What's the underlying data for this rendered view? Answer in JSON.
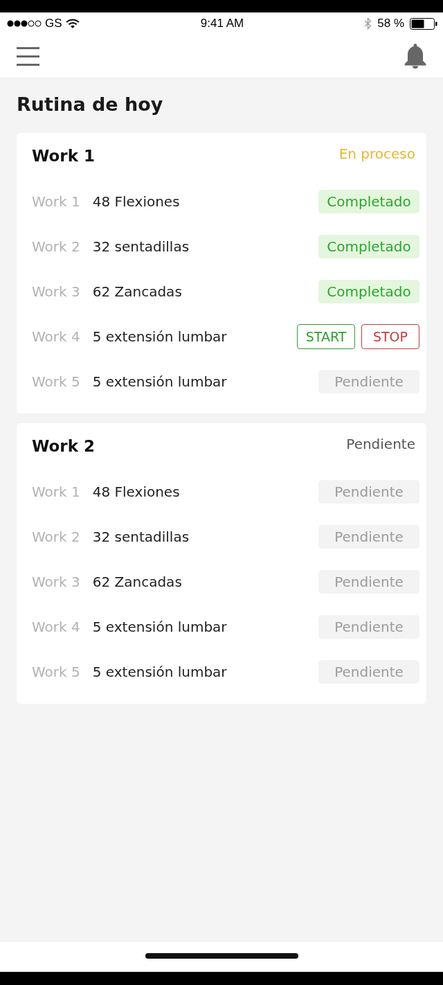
{
  "status_bar": {
    "carrier": "GS",
    "time": "9:41 AM",
    "battery": "58 %"
  },
  "title": "Rutina de hoy",
  "routines": [
    {
      "name": "Work 1",
      "status": {
        "text": "En proceso",
        "kind": "in_progress"
      },
      "exercises": [
        {
          "label": "Work 1",
          "name": "48 Flexiones",
          "kind": "status",
          "status": {
            "text": "Completado",
            "kind": "completed"
          }
        },
        {
          "label": "Work 2",
          "name": "32 sentadillas",
          "kind": "status",
          "status": {
            "text": "Completado",
            "kind": "completed"
          }
        },
        {
          "label": "Work 3",
          "name": "62 Zancadas",
          "kind": "status",
          "status": {
            "text": "Completado",
            "kind": "completed"
          }
        },
        {
          "label": "Work 4",
          "name": "5 extensión lumbar",
          "kind": "controls",
          "buttons": [
            {
              "text": "START",
              "kind": "start"
            },
            {
              "text": "STOP",
              "kind": "stop"
            }
          ]
        },
        {
          "label": "Work 5",
          "name": "5 extensión lumbar",
          "kind": "status",
          "status": {
            "text": "Pendiente",
            "kind": "pending"
          }
        }
      ]
    },
    {
      "name": "Work 2",
      "status": {
        "text": "Pendiente",
        "kind": "pending"
      },
      "exercises": [
        {
          "label": "Work 1",
          "name": "48 Flexiones",
          "kind": "status",
          "status": {
            "text": "Pendiente",
            "kind": "pending"
          }
        },
        {
          "label": "Work 2",
          "name": "32 sentadillas",
          "kind": "status",
          "status": {
            "text": "Pendiente",
            "kind": "pending"
          }
        },
        {
          "label": "Work 3",
          "name": "62 Zancadas",
          "kind": "status",
          "status": {
            "text": "Pendiente",
            "kind": "pending"
          }
        },
        {
          "label": "Work 4",
          "name": "5 extensión lumbar",
          "kind": "status",
          "status": {
            "text": "Pendiente",
            "kind": "pending"
          }
        },
        {
          "label": "Work 5",
          "name": "5 extensión lumbar",
          "kind": "status",
          "status": {
            "text": "Pendiente",
            "kind": "pending"
          }
        }
      ]
    }
  ]
}
